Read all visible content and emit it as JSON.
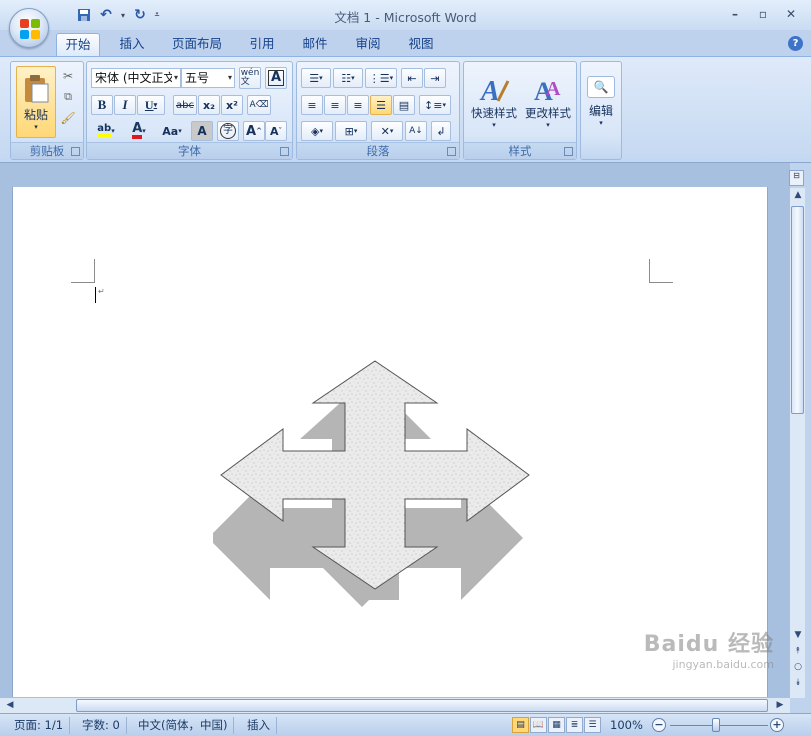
{
  "window": {
    "title": "文档 1 - Microsoft Word"
  },
  "qat": {
    "save_icon": "save-icon",
    "undo_icon": "undo-icon",
    "redo_icon": "redo-icon"
  },
  "tabs": [
    "开始",
    "插入",
    "页面布局",
    "引用",
    "邮件",
    "审阅",
    "视图"
  ],
  "ribbon": {
    "clipboard": {
      "paste_label": "粘贴",
      "group_label": "剪贴板"
    },
    "font": {
      "font_name": "宋体 (中文正文",
      "font_size": "五号",
      "group_label": "字体",
      "wen_label": "wén\n文",
      "bold": "B",
      "italic": "I",
      "underline": "U",
      "strike": "abc",
      "sub": "x₂",
      "sup": "x²",
      "change_case": "Aa",
      "char_shade": "A",
      "enclose": "字",
      "grow": "A",
      "shrink": "A"
    },
    "paragraph": {
      "group_label": "段落"
    },
    "styles": {
      "quick_styles_label": "快速样式",
      "change_styles_label": "更改样式",
      "group_label": "样式"
    },
    "editing": {
      "edit_label": "编辑"
    }
  },
  "statusbar": {
    "page": "页面: 1/1",
    "words": "字数: 0",
    "language": "中文(简体，中国)",
    "mode": "插入",
    "zoom": "100%"
  },
  "colors": {
    "ribbon_bg": "#c4d8f1",
    "highlight_yellow": "#ffff00",
    "font_red": "#e0191e",
    "shape_fill": "#e6e6e6"
  },
  "watermark": {
    "brand": "Baidu 经验",
    "url": "jingyan.baidu.com"
  }
}
